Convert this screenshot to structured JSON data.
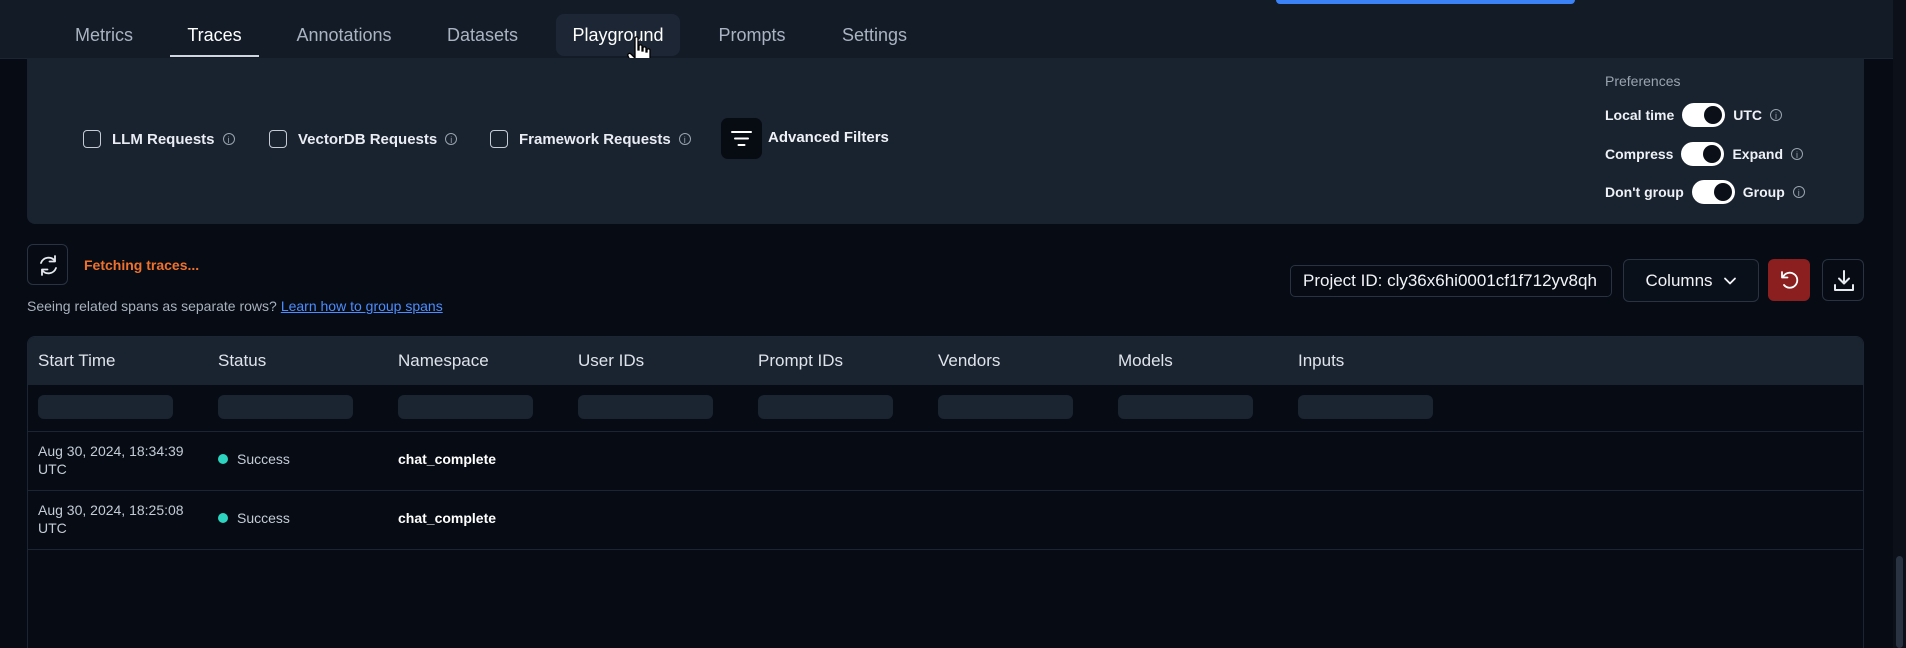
{
  "nav": {
    "tabs": [
      {
        "label": "Metrics"
      },
      {
        "label": "Traces"
      },
      {
        "label": "Annotations"
      },
      {
        "label": "Datasets"
      },
      {
        "label": "Playground"
      },
      {
        "label": "Prompts"
      },
      {
        "label": "Settings"
      }
    ],
    "active_tab": "Traces",
    "hovered_tab": "Playground"
  },
  "filters": {
    "checkboxes": [
      {
        "label": "LLM Requests",
        "checked": false
      },
      {
        "label": "VectorDB Requests",
        "checked": false
      },
      {
        "label": "Framework Requests",
        "checked": false
      }
    ],
    "advanced_label": "Advanced Filters"
  },
  "preferences": {
    "title": "Preferences",
    "rows": [
      {
        "left": "Local time",
        "right": "UTC",
        "state": "right"
      },
      {
        "left": "Compress",
        "right": "Expand",
        "state": "right"
      },
      {
        "left": "Don't group",
        "right": "Group",
        "state": "right"
      }
    ]
  },
  "toolbar": {
    "status": "Fetching traces...",
    "hint": "Seeing related spans as separate rows?",
    "hint_link": "Learn how to group spans",
    "project_id": "Project ID: cly36x6hi0001cf1f712yv8qh",
    "columns_label": "Columns"
  },
  "table": {
    "columns": [
      "Start Time",
      "Status",
      "Namespace",
      "User IDs",
      "Prompt IDs",
      "Vendors",
      "Models",
      "Inputs"
    ],
    "rows": [
      {
        "start_time": "Aug 30, 2024, 18:34:39 UTC",
        "status": "Success",
        "namespace": "chat_complete"
      },
      {
        "start_time": "Aug 30, 2024, 18:25:08 UTC",
        "status": "Success",
        "namespace": "chat_complete"
      }
    ]
  },
  "colors": {
    "accent": "#3b82f6",
    "status_success": "#2dd4bf",
    "fetching": "#f0712c",
    "undo": "#8b1f1f"
  }
}
